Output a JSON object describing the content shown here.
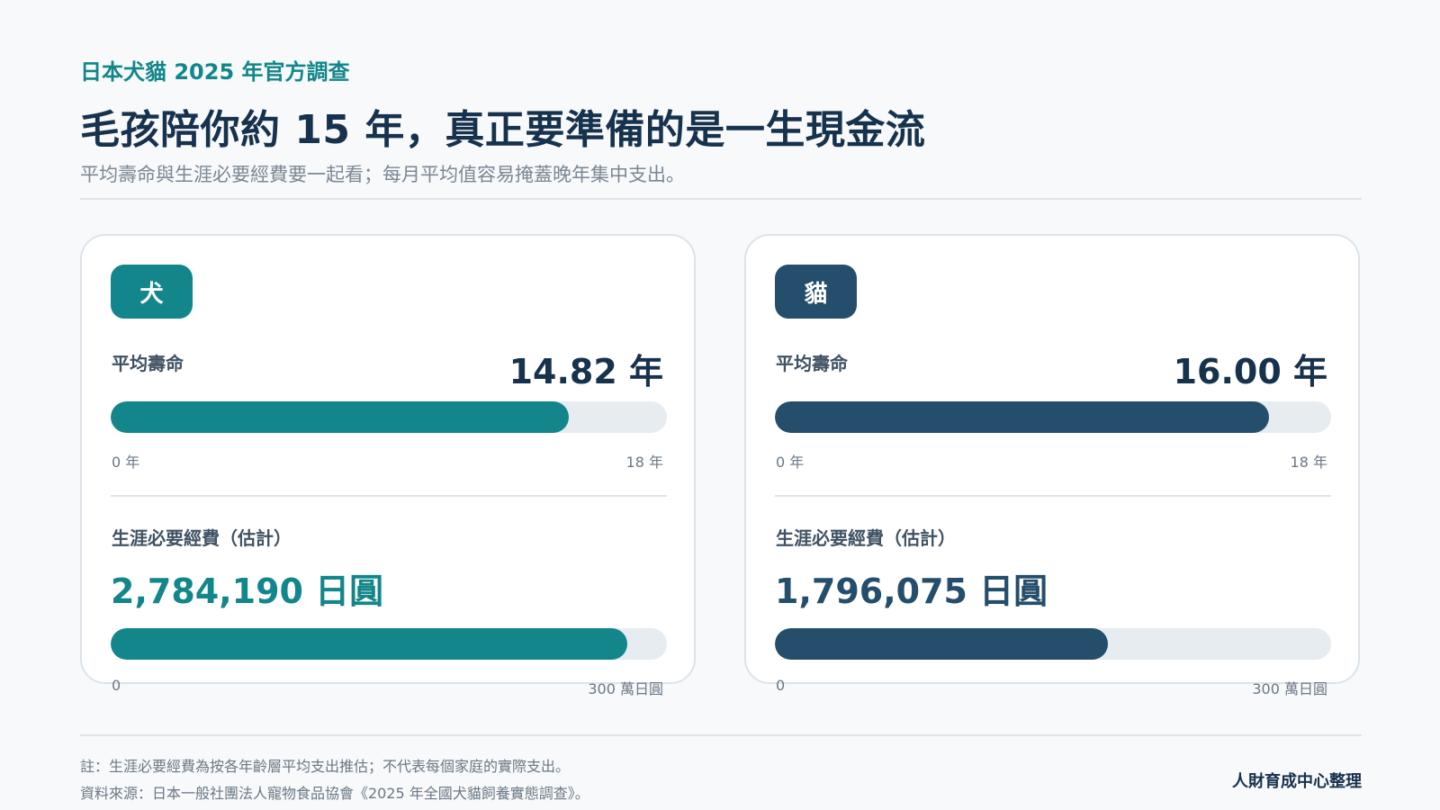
{
  "header": {
    "kicker": "日本犬貓 2025 年官方調查",
    "title": "毛孩陪你約 15 年，真正要準備的是一生現金流",
    "subtitle": "平均壽命與生涯必要經費要一起看；每月平均值容易掩蓋晚年集中支出。"
  },
  "colors": {
    "dog_accent": "#12868a",
    "cat_accent": "#244e6b",
    "track": "#e6ecf0"
  },
  "cards": [
    {
      "badge": "犬",
      "life_label": "平均壽命",
      "life_value": "14.82 年",
      "life_years": 14.82,
      "life_axis_min": "0 年",
      "life_axis_max": "18 年",
      "life_max": 18,
      "cost_label": "生涯必要經費（估計）",
      "cost_value": "2,784,190 日圓",
      "cost_yen": 2784190,
      "cost_axis_min": "0",
      "cost_axis_max": "300 萬日圓",
      "cost_max": 3000000
    },
    {
      "badge": "貓",
      "life_label": "平均壽命",
      "life_value": "16.00 年",
      "life_years": 16.0,
      "life_axis_min": "0 年",
      "life_axis_max": "18 年",
      "life_max": 18,
      "cost_label": "生涯必要經費（估計）",
      "cost_value": "1,796,075 日圓",
      "cost_yen": 1796075,
      "cost_axis_min": "0",
      "cost_axis_max": "300 萬日圓",
      "cost_max": 3000000
    }
  ],
  "footer": {
    "note1": "註：生涯必要經費為按各年齡層平均支出推估；不代表每個家庭的實際支出。",
    "note2": "資料來源：日本一般社團法人寵物食品協會《2025 年全國犬貓飼養實態調查》。",
    "credit": "人財育成中心整理"
  }
}
